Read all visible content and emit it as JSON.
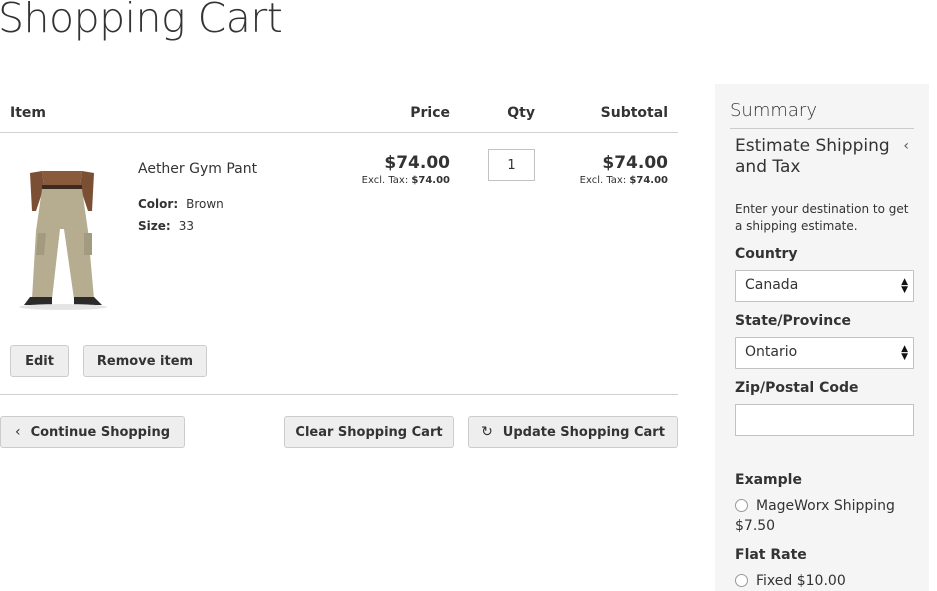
{
  "page": {
    "title": "Shopping Cart"
  },
  "table": {
    "headers": {
      "item": "Item",
      "price": "Price",
      "qty": "Qty",
      "subtotal": "Subtotal"
    }
  },
  "item": {
    "name": "Aether Gym Pant",
    "image_icon": "pants-product-image",
    "options": [
      {
        "label": "Color:",
        "value": "Brown"
      },
      {
        "label": "Size:",
        "value": "33"
      }
    ],
    "price": "$74.00",
    "price_excl_label": "Excl. Tax:",
    "price_excl_value": "$74.00",
    "qty": "1",
    "subtotal": "$74.00",
    "subtotal_excl_label": "Excl. Tax:",
    "subtotal_excl_value": "$74.00",
    "edit_label": "Edit",
    "remove_label": "Remove item"
  },
  "actions": {
    "continue_label": "Continue Shopping",
    "continue_icon": "chevron-left-icon",
    "clear_label": "Clear Shopping Cart",
    "update_label": "Update Shopping Cart",
    "update_icon": "refresh-icon"
  },
  "summary": {
    "title": "Summary",
    "estimate_title": "Estimate Shipping and Tax",
    "estimate_note": "Enter your destination to get a shipping estimate.",
    "country_label": "Country",
    "country_value": "Canada",
    "state_label": "State/Province",
    "state_value": "Ontario",
    "zip_label": "Zip/Postal Code",
    "zip_value": "",
    "carriers": [
      {
        "name": "Example",
        "method": "MageWorx Shipping",
        "price": "$7.50"
      },
      {
        "name": "Flat Rate",
        "method": "Fixed",
        "price": "$10.00"
      }
    ]
  },
  "colors": {
    "summary_bg": "#f5f5f5",
    "button_bg": "#eeeeee",
    "text": "#333333"
  }
}
